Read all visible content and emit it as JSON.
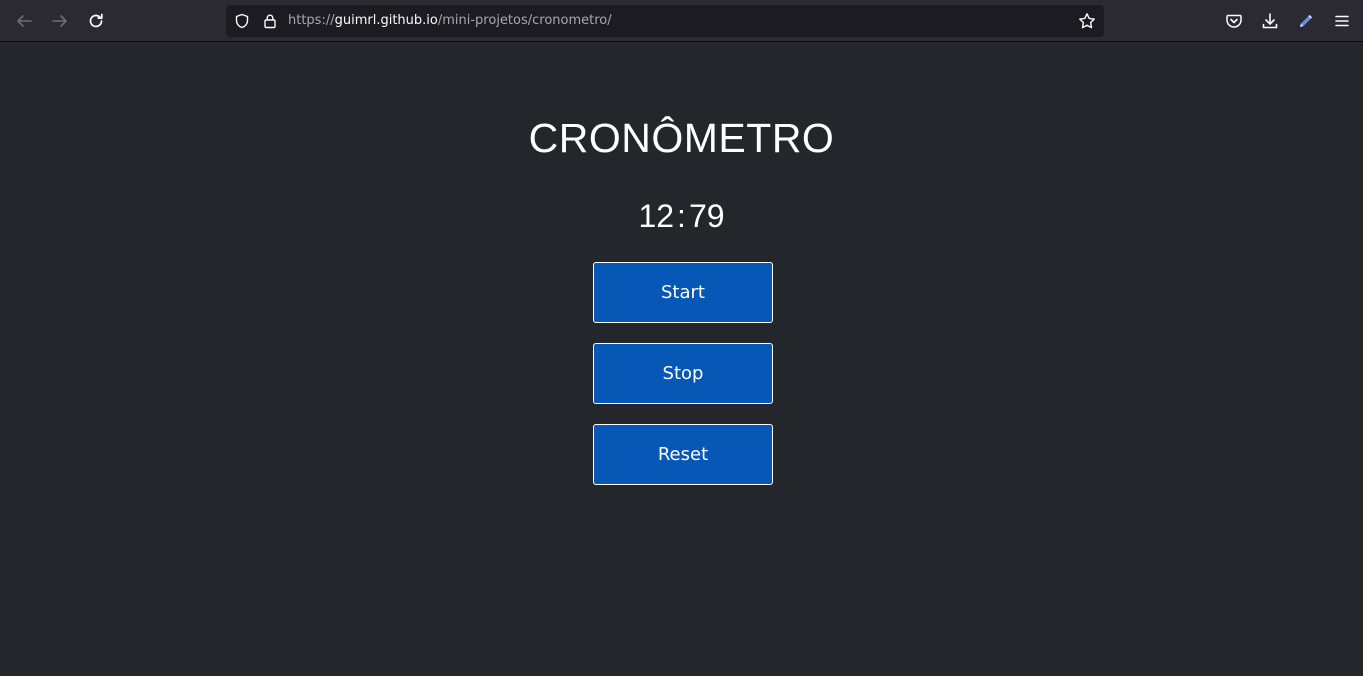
{
  "browser": {
    "url": {
      "scheme": "https://",
      "domain": "guimrl.github.io",
      "path": "/mini-projetos/cronometro/"
    },
    "icons": {
      "back": "back-arrow-icon",
      "forward": "forward-arrow-icon",
      "reload": "reload-icon",
      "shield": "shield-icon",
      "lock": "lock-icon",
      "bookmark": "star-icon",
      "pocket": "pocket-icon",
      "downloads": "download-icon",
      "extension": "pen-icon",
      "menu": "hamburger-menu-icon"
    }
  },
  "page": {
    "title": "CRONÔMETRO",
    "timer": {
      "minutes": "12",
      "separator": ":",
      "seconds": "79"
    },
    "buttons": {
      "start": "Start",
      "stop": "Stop",
      "reset": "Reset"
    }
  },
  "colors": {
    "background": "#23262a",
    "button": "#0757b6",
    "text": "#ffffff"
  }
}
